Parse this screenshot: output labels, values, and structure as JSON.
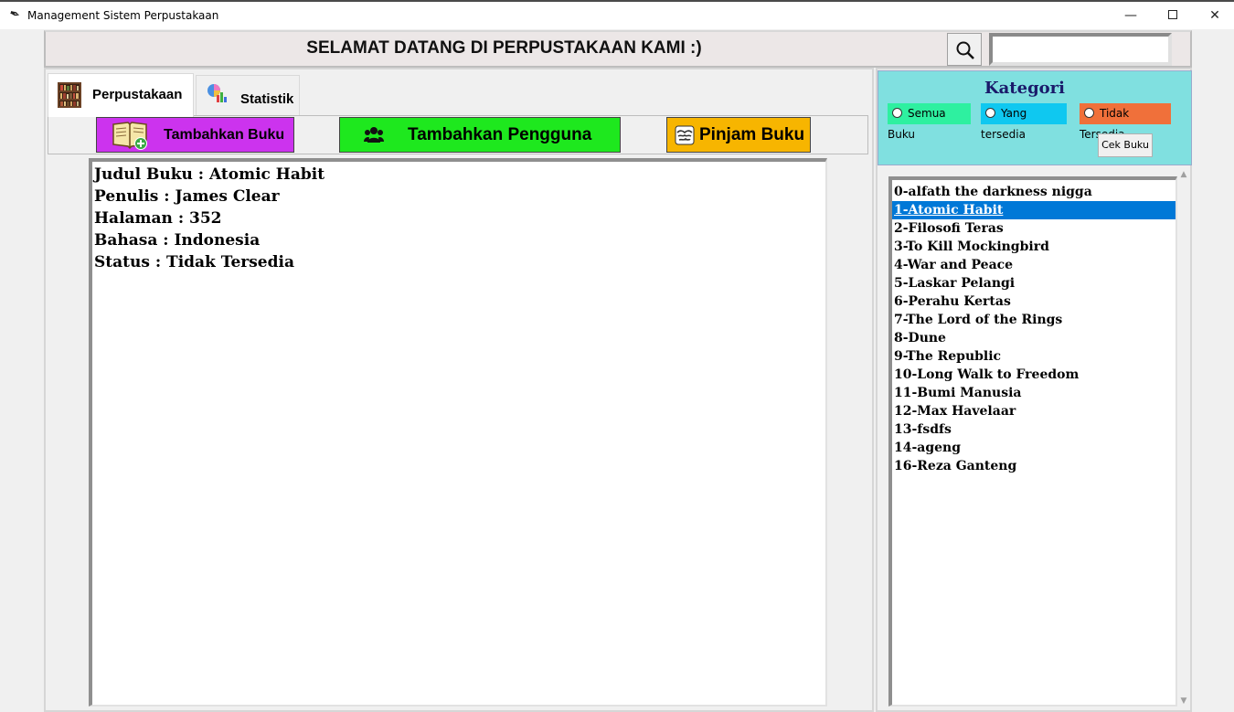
{
  "window": {
    "title": "Management Sistem Perpustakaan",
    "minimize": "—",
    "close": "✕"
  },
  "header": {
    "welcome": "SELAMAT DATANG DI PERPUSTAKAAN KAMI :)",
    "search_value": "",
    "search_icon": "search-icon"
  },
  "tabs": [
    {
      "label": "Perpustakaan",
      "icon": "bookshelf-icon",
      "active": true
    },
    {
      "label": "Statistik",
      "icon": "chart-icon",
      "active": false
    }
  ],
  "toolbar": {
    "add_book": {
      "label": "Tambahkan Buku",
      "color": "#cc33ee",
      "icon": "add-book-icon"
    },
    "add_user": {
      "label": "Tambahkan Pengguna",
      "color": "#1ee81e",
      "icon": "users-icon"
    },
    "borrow": {
      "label": "Pinjam Buku",
      "color": "#f7b500",
      "icon": "handshake-icon"
    }
  },
  "detail": {
    "lines": [
      "Judul Buku : Atomic Habit",
      "Penulis : James Clear",
      "Halaman : 352",
      "Bahasa : Indonesia",
      "Status : Tidak Tersedia"
    ]
  },
  "kategori": {
    "title": "Kategori",
    "options": [
      {
        "label": "Semua Buku",
        "color": "#2ef0a0"
      },
      {
        "label": "Yang tersedia",
        "color": "#0fc8f0"
      },
      {
        "label": "Tidak Tersedia",
        "color": "#f0703a"
      }
    ],
    "check_button": "Cek Buku",
    "panel_color": "#80e0e0"
  },
  "books": [
    "0-alfath the darkness nigga",
    "1-Atomic Habit",
    "2-Filosofi Teras",
    "3-To Kill Mockingbird",
    "4-War and Peace",
    "5-Laskar Pelangi",
    "6-Perahu Kertas",
    "7-The Lord of the Rings",
    "8-Dune",
    "9-The Republic",
    "10-Long Walk to Freedom",
    "11-Bumi Manusia",
    "12-Max Havelaar",
    "13-fsdfs",
    "14-ageng",
    "16-Reza Ganteng"
  ],
  "selected_book": "1-Atomic Habit"
}
